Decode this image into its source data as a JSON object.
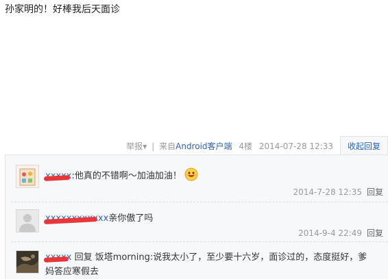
{
  "post": {
    "text": "孙家明的！好棒我后天面诊"
  },
  "meta": {
    "report_label": "举报",
    "client_prefix": "来自",
    "client_name": "Android客户端",
    "floor": "4楼",
    "date": "2014-07-28 12:33",
    "collapse_label": "收起回复"
  },
  "replies": [
    {
      "text": ":他真的不错啊～加油加油！",
      "date": "2014-7-28 12:35",
      "reply_label": "回复",
      "emoji": "grinning-face-icon"
    },
    {
      "text": "亲你傲了吗",
      "date": "2014-9-4 22:49",
      "reply_label": "回复"
    },
    {
      "reply_word": "回复",
      "target_user": "饭塔morning",
      "text_line1": ":说我太小了，至少要十六岁，面诊过的，态度挺好，爹",
      "text_line2": "妈答应寒假去"
    }
  ],
  "colors": {
    "link": "#2d64b3",
    "redaction": "#e8373a",
    "reply_bg": "#f7f8fa"
  }
}
